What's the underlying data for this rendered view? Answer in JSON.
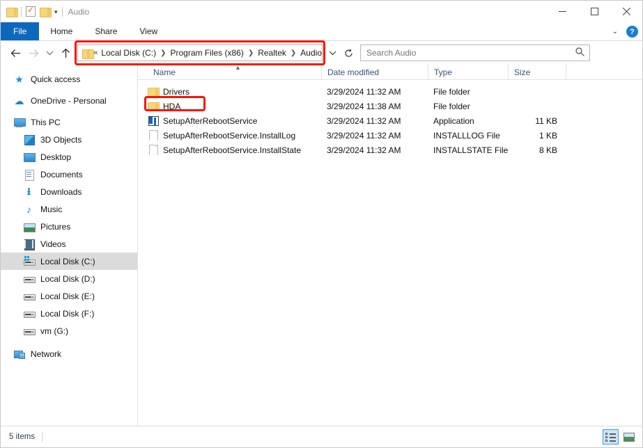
{
  "window": {
    "title": "Audio",
    "quick_access": {
      "folder_icon": "folder-icon",
      "properties_icon": "properties-icon",
      "new_folder_icon": "new-folder-icon",
      "customize_chevron": "chevron-down-icon"
    },
    "controls": {
      "minimize": "minimize-icon",
      "maximize": "maximize-icon",
      "close": "close-icon"
    }
  },
  "ribbon": {
    "tabs": [
      {
        "label": "File",
        "active": true
      },
      {
        "label": "Home",
        "active": false
      },
      {
        "label": "Share",
        "active": false
      },
      {
        "label": "View",
        "active": false
      }
    ],
    "collapse_icon": "chevron-down-icon",
    "help_label": "?"
  },
  "nav": {
    "back_icon": "arrow-left-icon",
    "forward_icon": "arrow-right-icon",
    "recent_icon": "chevron-down-icon",
    "up_icon": "arrow-up-icon"
  },
  "address": {
    "folder_icon": "folder-icon",
    "overflow": "«",
    "crumbs": [
      "Local Disk (C:)",
      "Program Files (x86)",
      "Realtek",
      "Audio"
    ],
    "dropdown_icon": "chevron-down-icon",
    "refresh_icon": "refresh-icon",
    "highlighted": true
  },
  "search": {
    "placeholder": "Search Audio",
    "icon": "search-icon"
  },
  "sidebar": {
    "items": [
      {
        "label": "Quick access",
        "icon": "star-icon",
        "indent": 0,
        "selected": false
      },
      {
        "label": "OneDrive - Personal",
        "icon": "cloud-icon",
        "indent": 0,
        "selected": false
      },
      {
        "label": "This PC",
        "icon": "computer-icon",
        "indent": 0,
        "selected": false
      },
      {
        "label": "3D Objects",
        "icon": "cube-icon",
        "indent": 1,
        "selected": false
      },
      {
        "label": "Desktop",
        "icon": "desktop-icon",
        "indent": 1,
        "selected": false
      },
      {
        "label": "Documents",
        "icon": "documents-icon",
        "indent": 1,
        "selected": false
      },
      {
        "label": "Downloads",
        "icon": "download-icon",
        "indent": 1,
        "selected": false
      },
      {
        "label": "Music",
        "icon": "music-icon",
        "indent": 1,
        "selected": false
      },
      {
        "label": "Pictures",
        "icon": "pictures-icon",
        "indent": 1,
        "selected": false
      },
      {
        "label": "Videos",
        "icon": "videos-icon",
        "indent": 1,
        "selected": false
      },
      {
        "label": "Local Disk (C:)",
        "icon": "system-drive-icon",
        "indent": 1,
        "selected": true
      },
      {
        "label": "Local Disk (D:)",
        "icon": "drive-icon",
        "indent": 1,
        "selected": false
      },
      {
        "label": "Local Disk (E:)",
        "icon": "drive-icon",
        "indent": 1,
        "selected": false
      },
      {
        "label": "Local Disk (F:)",
        "icon": "drive-icon",
        "indent": 1,
        "selected": false
      },
      {
        "label": "vm (G:)",
        "icon": "drive-icon",
        "indent": 1,
        "selected": false
      },
      {
        "label": "Network",
        "icon": "network-icon",
        "indent": 0,
        "selected": false
      }
    ]
  },
  "filelist": {
    "columns": [
      "Name",
      "Date modified",
      "Type",
      "Size"
    ],
    "sort_indicator": "caret-up-icon",
    "rows": [
      {
        "name": "Drivers",
        "icon": "folder-icon",
        "date": "3/29/2024 11:32 AM",
        "type": "File folder",
        "size": "",
        "highlighted": false
      },
      {
        "name": "HDA",
        "icon": "folder-icon",
        "date": "3/29/2024 11:38 AM",
        "type": "File folder",
        "size": "",
        "highlighted": true
      },
      {
        "name": "SetupAfterRebootService",
        "icon": "application-icon",
        "date": "3/29/2024 11:32 AM",
        "type": "Application",
        "size": "11 KB",
        "highlighted": false
      },
      {
        "name": "SetupAfterRebootService.InstallLog",
        "icon": "file-icon",
        "date": "3/29/2024 11:32 AM",
        "type": "INSTALLLOG File",
        "size": "1 KB",
        "highlighted": false
      },
      {
        "name": "SetupAfterRebootService.InstallState",
        "icon": "file-icon",
        "date": "3/29/2024 11:32 AM",
        "type": "INSTALLSTATE File",
        "size": "8 KB",
        "highlighted": false
      }
    ]
  },
  "status": {
    "item_count": "5 items",
    "details_view_icon": "details-view-icon",
    "large_icons_view_icon": "large-icons-view-icon"
  },
  "colors": {
    "accent": "#0d68bd",
    "annotation": "#fb1200",
    "selection": "#dbdbdb",
    "header_text": "#35537a"
  }
}
